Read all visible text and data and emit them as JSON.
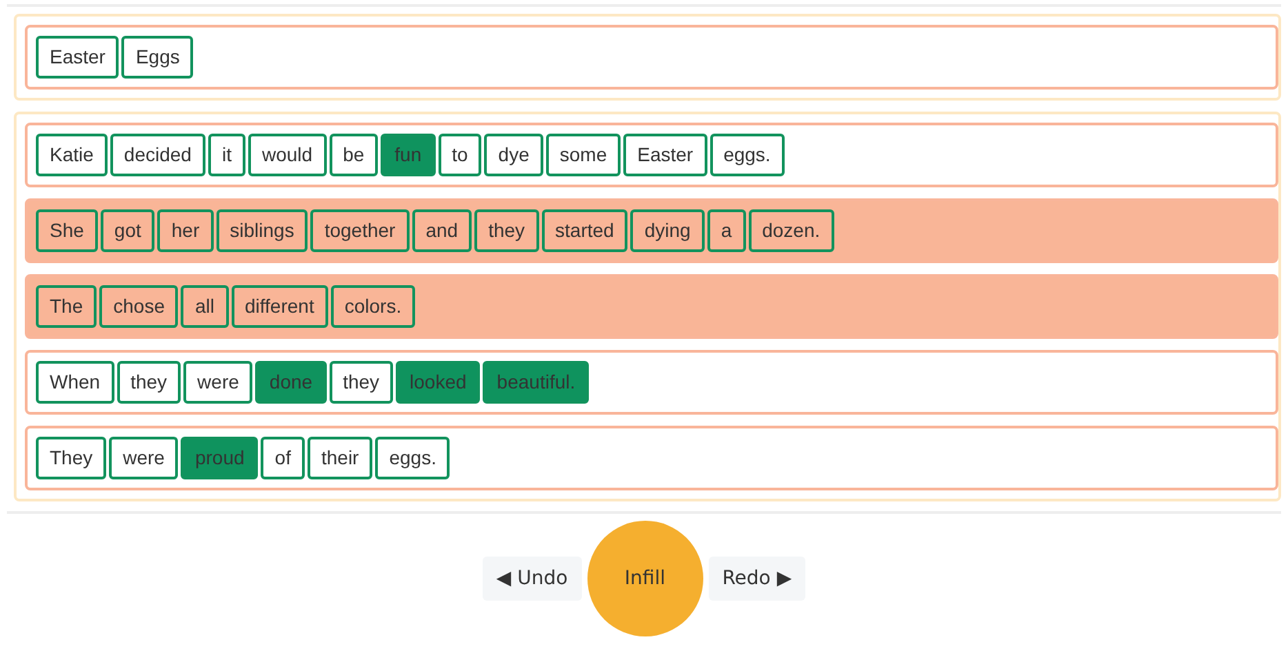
{
  "title": {
    "words": [
      {
        "text": "Easter",
        "selected": false
      },
      {
        "text": "Eggs",
        "selected": false
      }
    ]
  },
  "story": {
    "sentences": [
      {
        "selected": false,
        "words": [
          {
            "text": "Katie",
            "selected": false
          },
          {
            "text": "decided",
            "selected": false
          },
          {
            "text": "it",
            "selected": false
          },
          {
            "text": "would",
            "selected": false
          },
          {
            "text": "be",
            "selected": false
          },
          {
            "text": "fun",
            "selected": true
          },
          {
            "text": "to",
            "selected": false
          },
          {
            "text": "dye",
            "selected": false
          },
          {
            "text": "some",
            "selected": false
          },
          {
            "text": "Easter",
            "selected": false
          },
          {
            "text": "eggs.",
            "selected": false
          }
        ]
      },
      {
        "selected": true,
        "words": [
          {
            "text": "She",
            "selected": false
          },
          {
            "text": "got",
            "selected": false
          },
          {
            "text": "her",
            "selected": false
          },
          {
            "text": "siblings",
            "selected": false
          },
          {
            "text": "together",
            "selected": false
          },
          {
            "text": "and",
            "selected": false
          },
          {
            "text": "they",
            "selected": false
          },
          {
            "text": "started",
            "selected": false
          },
          {
            "text": "dying",
            "selected": false
          },
          {
            "text": "a",
            "selected": false
          },
          {
            "text": "dozen.",
            "selected": false
          }
        ]
      },
      {
        "selected": true,
        "words": [
          {
            "text": "The",
            "selected": false
          },
          {
            "text": "chose",
            "selected": false
          },
          {
            "text": "all",
            "selected": false
          },
          {
            "text": "different",
            "selected": false
          },
          {
            "text": "colors.",
            "selected": false
          }
        ]
      },
      {
        "selected": false,
        "words": [
          {
            "text": "When",
            "selected": false
          },
          {
            "text": "they",
            "selected": false
          },
          {
            "text": "were",
            "selected": false
          },
          {
            "text": "done",
            "selected": true
          },
          {
            "text": "they",
            "selected": false
          },
          {
            "text": "looked",
            "selected": true
          },
          {
            "text": "beautiful.",
            "selected": true
          }
        ]
      },
      {
        "selected": false,
        "words": [
          {
            "text": "They",
            "selected": false
          },
          {
            "text": "were",
            "selected": false
          },
          {
            "text": "proud",
            "selected": true
          },
          {
            "text": "of",
            "selected": false
          },
          {
            "text": "their",
            "selected": false
          },
          {
            "text": "eggs.",
            "selected": false
          }
        ]
      }
    ]
  },
  "buttons": [
    {
      "kind": "undo",
      "label": "◀ Undo"
    },
    {
      "kind": "infill",
      "label": "Infill"
    },
    {
      "kind": "redo",
      "label": "Redo ▶"
    }
  ]
}
